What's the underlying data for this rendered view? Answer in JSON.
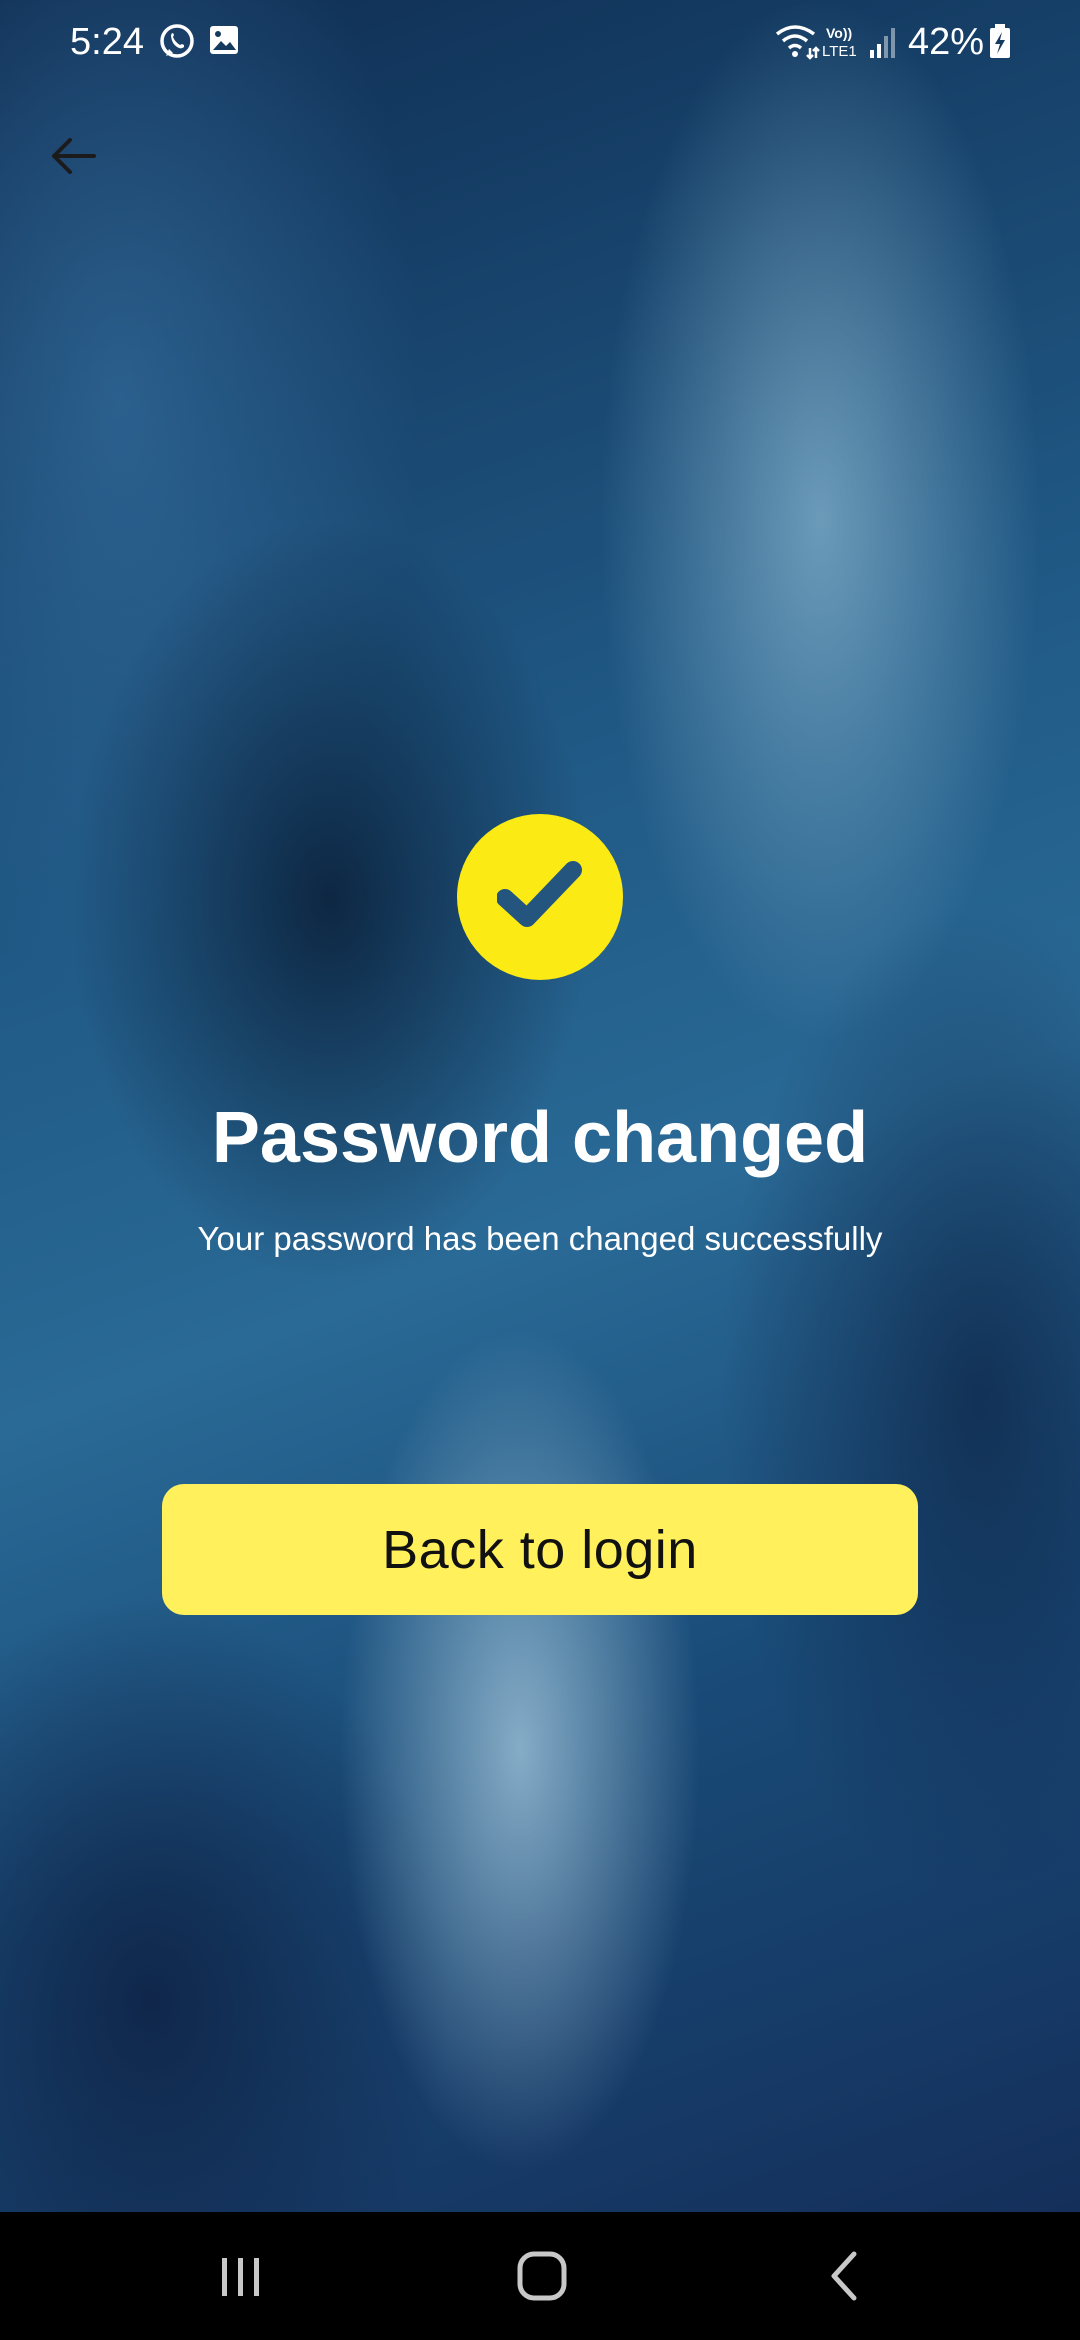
{
  "status_bar": {
    "time": "5:24",
    "battery_percent": "42%",
    "icons": [
      "whatsapp-icon",
      "image-icon",
      "wifi-icon",
      "volte-lte-icon",
      "signal-icon",
      "battery-charging-icon"
    ],
    "volte_label_top": "Vo))",
    "volte_label_bottom": "LTE1"
  },
  "header": {
    "back_icon": "arrow-left-icon"
  },
  "success": {
    "icon": "check-icon",
    "icon_color": "#fbea13",
    "title": "Password changed",
    "message": "Your password has been changed successfully"
  },
  "actions": {
    "back_to_login_label": "Back to login",
    "button_color": "#fff05c"
  },
  "nav_bar": {
    "icons": [
      "recent-apps-icon",
      "home-icon",
      "back-icon"
    ]
  }
}
